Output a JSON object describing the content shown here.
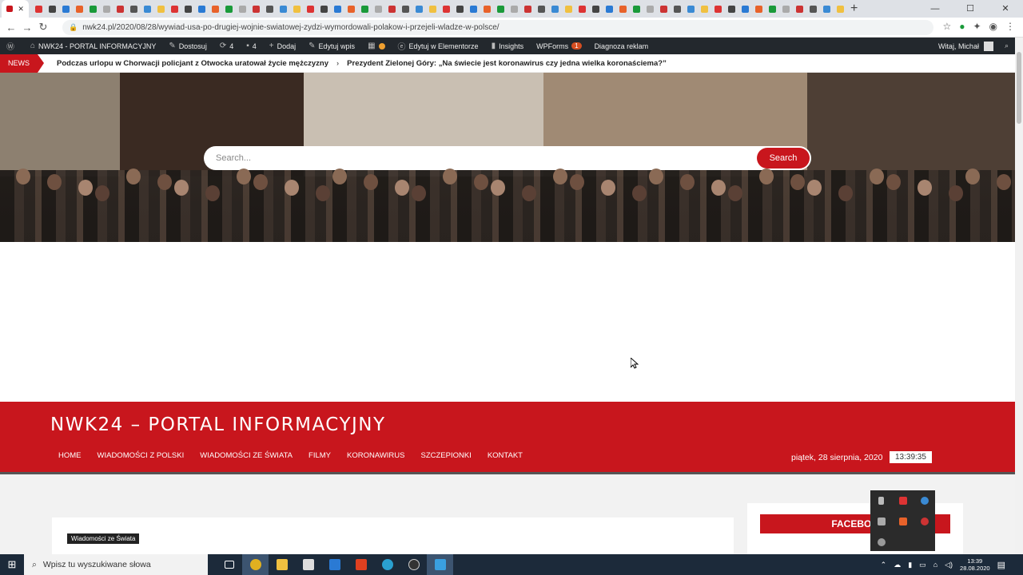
{
  "browser": {
    "url": "nwk24.pl/2020/08/28/wywiad-usa-po-drugiej-wojnie-swiatowej-zydzi-wymordowali-polakow-i-przejeli-wladze-w-polsce/",
    "window_controls": [
      "—",
      "☐",
      "✕"
    ]
  },
  "wpbar": {
    "site_name": "NWK24 - PORTAL INFORMACYJNY",
    "customize": "Dostosuj",
    "updates_count": "4",
    "comments_count": "4",
    "add": "Dodaj",
    "edit_post": "Edytuj wpis",
    "elementor": "Edytuj w Elementorze",
    "insights": "Insights",
    "wpforms": "WPForms",
    "wpforms_badge": "1",
    "ads_diag": "Diagnoza reklam",
    "user_greeting": "Witaj, Michał"
  },
  "ticker": {
    "label": "NEWS",
    "items": [
      "Podczas urlopu w Chorwacji policjant z Otwocka uratował życie mężczyzny",
      "Prezydent Zielonej Góry: „Na świecie jest koronawirus czy jedna wielka koronaściema?”"
    ]
  },
  "search": {
    "placeholder": "Search...",
    "button": "Search"
  },
  "site": {
    "title": "NWK24 – PORTAL INFORMACYJNY",
    "nav": [
      "HOME",
      "WIADOMOŚCI Z POLSKI",
      "WIADOMOŚCI ZE ŚWIATA",
      "FILMY",
      "KORONAWIRUS",
      "SZCZEPIONKI",
      "KONTAKT"
    ],
    "date": "piątek, 28 sierpnia, 2020",
    "clock": "13:39:35"
  },
  "article": {
    "category": "Wiadomości ze Świata"
  },
  "sidebar": {
    "facebook_label": "FACEBOO"
  },
  "taskbar": {
    "search_placeholder": "Wpisz tu wyszukiwane słowa",
    "time": "13:39",
    "date": "28.08.2020"
  },
  "colors": {
    "brand_red": "#c8161d",
    "wp_bar": "#23282d",
    "taskbar": "#1c2a3a"
  }
}
